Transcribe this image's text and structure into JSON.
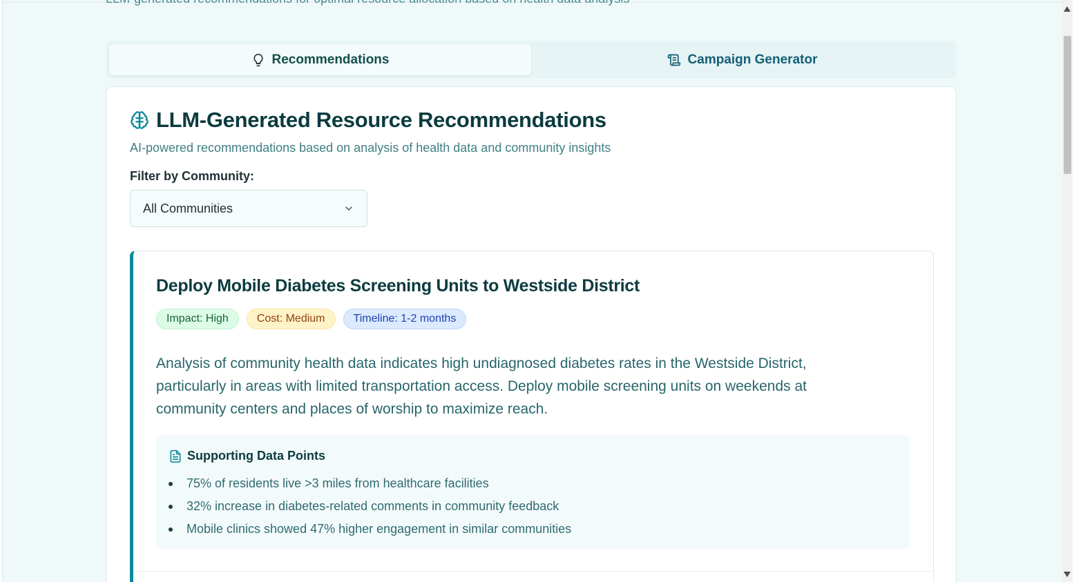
{
  "page": {
    "subtitle": "LLM-generated recommendations for optimal resource allocation based on health data analysis"
  },
  "tabs": [
    {
      "label": "Recommendations",
      "icon": "lightbulb-icon",
      "active": true
    },
    {
      "label": "Campaign Generator",
      "icon": "scroll-icon",
      "active": false
    }
  ],
  "card": {
    "title": "LLM-Generated Resource Recommendations",
    "title_icon": "brain-icon",
    "subtitle": "AI-powered recommendations based on analysis of health data and community insights",
    "filter_label": "Filter by Community:",
    "filter_value": "All Communities"
  },
  "recommendation": {
    "title": "Deploy Mobile Diabetes Screening Units to Westside District",
    "badges": {
      "impact": "Impact: High",
      "cost": "Cost: Medium",
      "timeline": "Timeline: 1-2 months"
    },
    "description": "Analysis of community health data indicates high undiagnosed diabetes rates in the Westside District, particularly in areas with limited transportation access. Deploy mobile screening units on weekends at community centers and places of worship to maximize reach.",
    "support_heading": "Supporting Data Points",
    "support_points": [
      "75% of residents live >3 miles from healthcare facilities",
      "32% increase in diabetes-related comments in community feedback",
      "Mobile clinics showed 47% higher engagement in similar communities"
    ]
  },
  "colors": {
    "accent": "#0e8a9a",
    "impact_bg": "#dcfce7",
    "cost_bg": "#fef3c7",
    "timeline_bg": "#dbeafe"
  }
}
